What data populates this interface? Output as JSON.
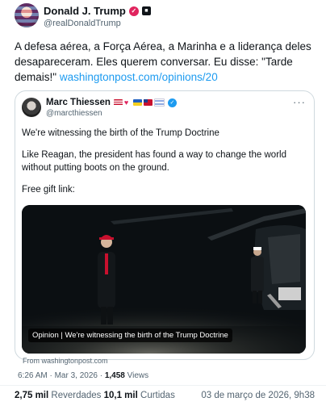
{
  "post": {
    "author_name": "Donald J. Trump",
    "author_handle": "@realDonaldTrump",
    "text_prefix": "A defesa aérea, a Força Aérea, a Marinha e a liderança deles desapareceram. Eles querem conversar. Eu disse: \"Tarde demais!\" ",
    "link": "washingtonpost.com/opinions/20"
  },
  "quote": {
    "author_name": "Marc Thiessen",
    "author_handle": "@marcthiessen",
    "more": "···",
    "line1": "We're witnessing the birth of the Trump Doctrine",
    "line2": "Like Reagan, the president has found a way to change the world without putting boots on the ground.",
    "line3": "Free gift link:",
    "media_caption": "Opinion | We're witnessing the birth of the Trump Doctrine"
  },
  "source": "From washingtonpost.com",
  "meta": {
    "time": "6:26 AM · Mar 3, 2026 · ",
    "views_count": "1,458",
    "views_label": " Views"
  },
  "stats": {
    "reposts_count": "2,75 mil",
    "reposts_label": " Reverdades  ",
    "likes_count": "10,1 mil",
    "likes_label": " Curtidas",
    "date": "03 de março de 2026, 9h38"
  },
  "colors": {
    "link": "#1d9bf0",
    "text": "#0f1419",
    "muted": "#536471",
    "border": "#cfd9de"
  },
  "icons": [
    "verified-badge-icon",
    "square-badge-icon",
    "more-icon",
    "verified-icon"
  ]
}
